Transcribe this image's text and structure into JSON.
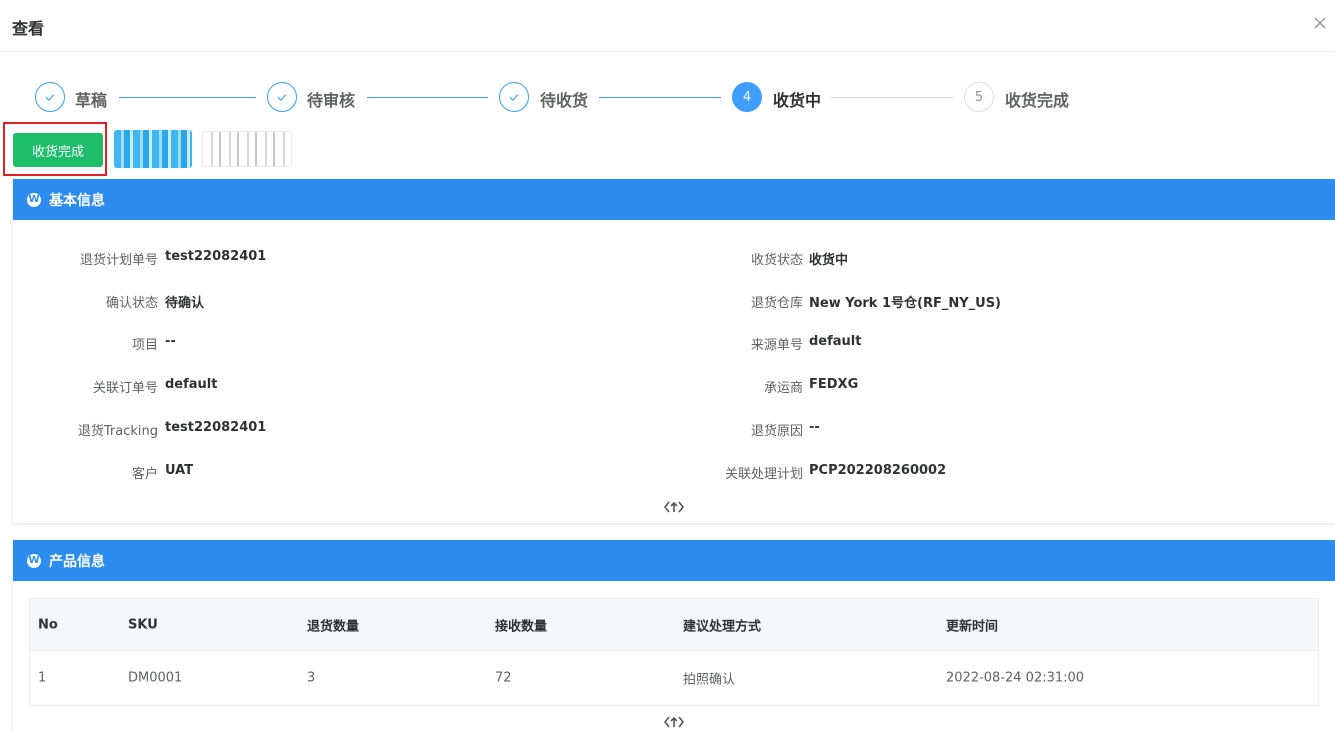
{
  "dialog": {
    "title": "查看"
  },
  "steps": [
    {
      "label": "草稿",
      "status": "done",
      "icon": "check-icon"
    },
    {
      "label": "待审核",
      "status": "done",
      "icon": "check-icon"
    },
    {
      "label": "待收货",
      "status": "done",
      "icon": "check-icon"
    },
    {
      "label": "收货中",
      "status": "active",
      "number": "4"
    },
    {
      "label": "收货完成",
      "status": "wait",
      "number": "5"
    }
  ],
  "actions": {
    "complete_label": "收货完成"
  },
  "basic_info": {
    "title": "基本信息",
    "left": [
      {
        "label": "退货计划单号",
        "value": "test22082401"
      },
      {
        "label": "确认状态",
        "value": "待确认"
      },
      {
        "label": "项目",
        "value": "--"
      },
      {
        "label": "关联订单号",
        "value": "default"
      },
      {
        "label": "退货Tracking",
        "value": "test22082401"
      },
      {
        "label": "客户",
        "value": "UAT"
      }
    ],
    "right": [
      {
        "label": "收货状态",
        "value": "收货中"
      },
      {
        "label": "退货仓库",
        "value": "New York 1号仓(RF_NY_US)"
      },
      {
        "label": "来源单号",
        "value": "default"
      },
      {
        "label": "承运商",
        "value": "FEDXG"
      },
      {
        "label": "退货原因",
        "value": "--"
      },
      {
        "label": "关联处理计划",
        "value": "PCP202208260002"
      }
    ]
  },
  "product_info": {
    "title": "产品信息",
    "columns": [
      "No",
      "SKU",
      "退货数量",
      "接收数量",
      "建议处理方式",
      "更新时间"
    ],
    "rows": [
      [
        "1",
        "DM0001",
        "3",
        "72",
        "拍照确认",
        "2022-08-24 02:31:00"
      ]
    ]
  },
  "colors": {
    "primary": "#409eff",
    "panel_header": "#2d8cf0",
    "success": "#1dbd6a",
    "highlight": "#e02020"
  }
}
